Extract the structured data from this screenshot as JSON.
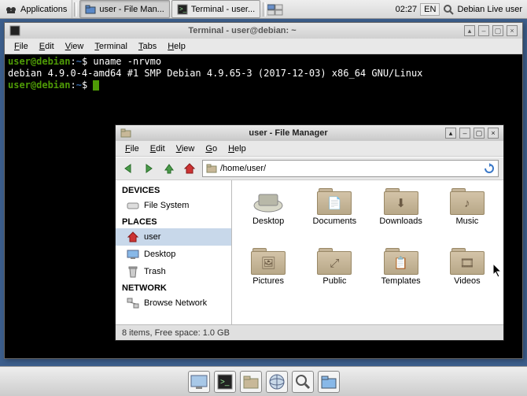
{
  "panel": {
    "applications": "Applications",
    "task1": "user - File Man...",
    "task2": "Terminal - user...",
    "clock": "02:27",
    "lang": "EN",
    "user": "Debian Live user"
  },
  "terminal": {
    "title": "Terminal - user@debian: ~",
    "menu": [
      "File",
      "Edit",
      "View",
      "Terminal",
      "Tabs",
      "Help"
    ],
    "prompt_user": "user@debian",
    "prompt_path": "~",
    "cmd": "uname -nrvmo",
    "output": "debian 4.9.0-4-amd64 #1 SMP Debian 4.9.65-3 (2017-12-03) x86_64 GNU/Linux"
  },
  "fm": {
    "title": "user - File Manager",
    "menu": [
      "File",
      "Edit",
      "View",
      "Go",
      "Help"
    ],
    "path": "/home/user/",
    "devices_head": "DEVICES",
    "places_head": "PLACES",
    "network_head": "NETWORK",
    "dev_fs": "File System",
    "pl_user": "user",
    "pl_desktop": "Desktop",
    "pl_trash": "Trash",
    "net_browse": "Browse Network",
    "items": {
      "desktop": "Desktop",
      "documents": "Documents",
      "downloads": "Downloads",
      "music": "Music",
      "pictures": "Pictures",
      "public": "Public",
      "templates": "Templates",
      "videos": "Videos"
    },
    "status": "8 items, Free space: 1.0 GB"
  }
}
